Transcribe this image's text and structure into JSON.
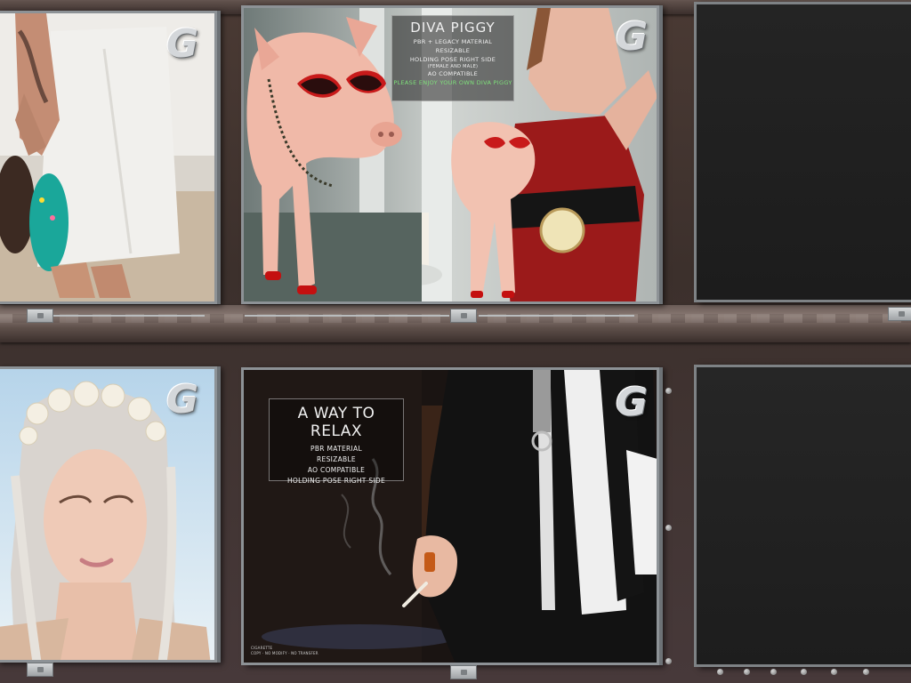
{
  "scene": "vendor-wall",
  "panels": {
    "shorts": {
      "logo": "G"
    },
    "diva_piggy": {
      "logo": "G",
      "title": "DIVA PIGGY",
      "lines": [
        "PBR + LEGACY MATERIAL",
        "RESIZABLE",
        "HOLDING POSE RIGHT SIDE",
        "(FEMALE AND MALE)",
        "AO COMPATIBLE"
      ],
      "highlight": "PLEASE ENJOY YOUR OWN DIVA PIGGY"
    },
    "flower_crown": {
      "logo": "G"
    },
    "a_way_to_relax": {
      "logo": "G",
      "title": "A WAY TO RELAX",
      "lines": [
        "PBR MATERIAL",
        "RESIZABLE",
        "AO COMPATIBLE",
        "HOLDING POSE RIGHT SIDE"
      ],
      "credit_1": "CIGARETTE",
      "credit_2": "COPY · NO MODIFY · NO TRANSFER"
    },
    "empty_top_right": {},
    "empty_bottom_right": {}
  },
  "colors": {
    "panel_frame": "#8d9296",
    "wall": "#4a3a34",
    "info_green": "#7ee07a",
    "dress_red": "#9b1a1a"
  }
}
